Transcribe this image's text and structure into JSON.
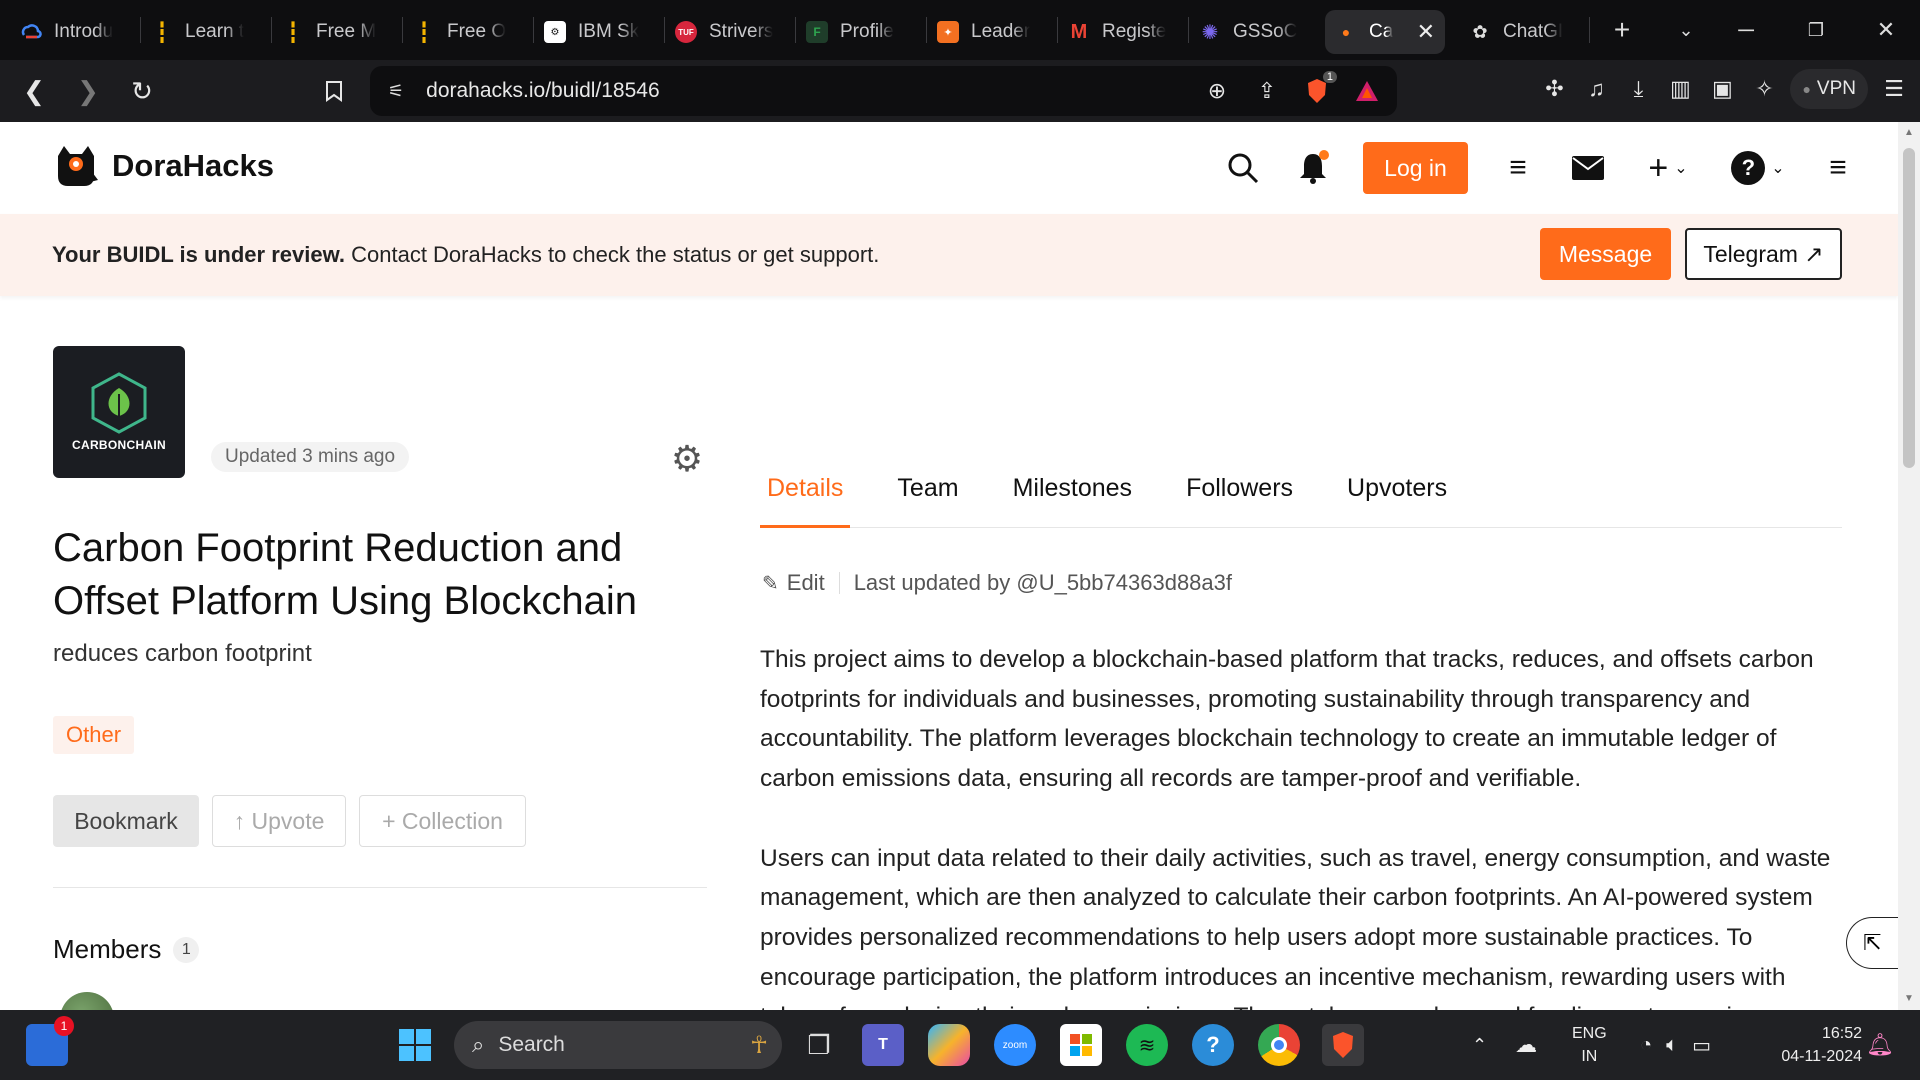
{
  "browser": {
    "tabs": [
      {
        "label": "Introdu",
        "fav_color": "#1a73e8",
        "icon": "google-cloud-icon"
      },
      {
        "label": "Learn t",
        "fav_color": "#f4b400",
        "icon": "candle-icon"
      },
      {
        "label": "Free M",
        "fav_color": "#f4b400",
        "icon": "candle-icon"
      },
      {
        "label": "Free O",
        "fav_color": "#f4b400",
        "icon": "candle-icon"
      },
      {
        "label": "IBM Sk",
        "fav_color": "#ffffff",
        "icon": "ibm-icon"
      },
      {
        "label": "Strivers",
        "fav_color": "#d7263d",
        "icon": "tuf-icon"
      },
      {
        "label": "Profile",
        "fav_color": "#2ea44f",
        "icon": "profile-icon"
      },
      {
        "label": "Leader",
        "fav_color": "#f37021",
        "icon": "leader-icon"
      },
      {
        "label": "Registe",
        "fav_color": "#ea4335",
        "icon": "gmail-icon"
      },
      {
        "label": "GSSoC",
        "fav_color": "#6a5acd",
        "icon": "gssoc-icon"
      },
      {
        "label": "Ca",
        "fav_color": "#222222",
        "icon": "dorahacks-icon",
        "active": true
      },
      {
        "label": "ChatGI",
        "fav_color": "#ffffff",
        "icon": "chatgpt-icon"
      }
    ],
    "url": "dorahacks.io/buidl/18546",
    "brave_badge": "1",
    "vpn_label": "VPN"
  },
  "site": {
    "brand": "DoraHacks",
    "login_label": "Log in"
  },
  "banner": {
    "bold": "Your BUIDL is under review.",
    "text": " Contact DoraHacks to check the status or get support.",
    "message_label": "Message",
    "telegram_label": "Telegram ↗"
  },
  "project": {
    "logo_text": "CARBONCHAIN",
    "updated": "Updated 3 mins ago",
    "title": "Carbon Footprint Reduction and Offset Platform Using Blockchain",
    "tagline": "reduces carbon footprint",
    "tag": "Other",
    "bookmark_label": "Bookmark",
    "upvote_label": "↑ Upvote",
    "collection_label": "+ Collection",
    "members_label": "Members",
    "members_count": "1"
  },
  "detail_tabs": [
    "Details",
    "Team",
    "Milestones",
    "Followers",
    "Upvoters"
  ],
  "details": {
    "edit_label": "Edit",
    "last_updated": "Last updated by @U_5bb74363d88a3f",
    "paragraphs": [
      "This project aims to develop a blockchain-based platform that tracks, reduces, and offsets carbon footprints for individuals and businesses, promoting sustainability through transparency and accountability. The platform leverages blockchain technology to create an immutable ledger of carbon emissions data, ensuring all records are tamper-proof and verifiable.",
      "Users can input data related to their daily activities, such as travel, energy consumption, and waste management, which are then analyzed to calculate their carbon footprints. An AI-powered system provides personalized recommendations to help users adopt more sustainable practices. To encourage participation, the platform introduces an incentive mechanism, rewarding users with tokens for reducing their carbon emissions. These tokens can be used for discounts, services, or exchanged within a rewards ecosystem."
    ]
  },
  "taskbar": {
    "search_label": "Search",
    "notif_badge": "1",
    "lang_line1": "ENG",
    "lang_line2": "IN",
    "time": "16:52",
    "date": "04-11-2024"
  },
  "colors": {
    "accent": "#ff6b1a",
    "banner_bg": "#fdf1ec"
  }
}
